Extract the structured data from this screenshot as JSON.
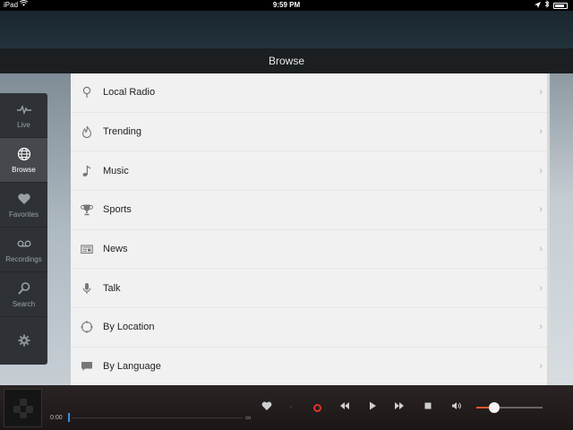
{
  "status_bar": {
    "device": "iPad",
    "time": "9:59 PM"
  },
  "header": {
    "title": "Browse"
  },
  "sidebar": {
    "items": [
      {
        "label": "Live",
        "icon": "pulse-icon"
      },
      {
        "label": "Browse",
        "icon": "globe-icon",
        "active": true
      },
      {
        "label": "Favorites",
        "icon": "heart-icon"
      },
      {
        "label": "Recordings",
        "icon": "voicemail-icon"
      },
      {
        "label": "Search",
        "icon": "search-icon"
      },
      {
        "label": "",
        "icon": "gear-icon"
      }
    ]
  },
  "browse_list": {
    "items": [
      {
        "label": "Local Radio",
        "icon": "location-pin-icon"
      },
      {
        "label": "Trending",
        "icon": "flame-icon"
      },
      {
        "label": "Music",
        "icon": "music-note-icon"
      },
      {
        "label": "Sports",
        "icon": "trophy-icon"
      },
      {
        "label": "News",
        "icon": "newspaper-icon"
      },
      {
        "label": "Talk",
        "icon": "microphone-icon"
      },
      {
        "label": "By Location",
        "icon": "compass-icon"
      },
      {
        "label": "By Language",
        "icon": "speech-bubble-icon"
      }
    ]
  },
  "player": {
    "elapsed": "0:00",
    "volume_level": 0.27,
    "colors": {
      "record": "#e0352b",
      "volume_accent": "#e25a2a",
      "progress_marker": "#3a8fd9"
    }
  }
}
